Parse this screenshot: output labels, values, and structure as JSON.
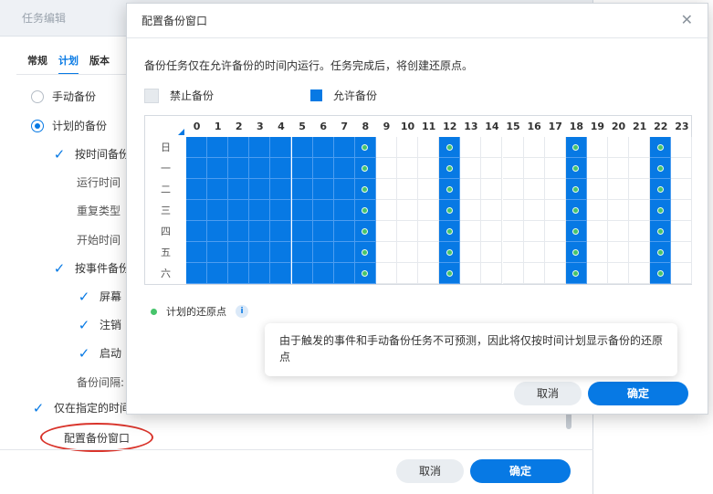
{
  "background_dialog": {
    "title": "任务编辑",
    "tabs": [
      {
        "label": "常规",
        "active": false
      },
      {
        "label": "计划",
        "active": true
      },
      {
        "label": "版本",
        "active": false
      }
    ],
    "options": {
      "manual_backup": "手动备份",
      "scheduled_backup": "计划的备份",
      "time_based_backup": "按时间备份",
      "run_time": "运行时间",
      "repeat_type": "重复类型",
      "start_time": "开始时间",
      "event_based_backup": "按事件备份",
      "event_screen": "屏幕",
      "event_logout": "注销",
      "event_startup": "启动",
      "backup_interval": "备份间隔:",
      "only_in_window": "仅在指定的时间"
    },
    "configure_link": "配置备份窗口",
    "cancel_label": "取消",
    "ok_label": "确定"
  },
  "dialog": {
    "title": "配置备份窗口",
    "close_icon": "close-icon",
    "description": "备份任务仅在允许备份的时间内运行。任务完成后，将创建还原点。",
    "legend": {
      "forbid": "禁止备份",
      "allow": "允许备份"
    },
    "restore_point_label": "计划的还原点",
    "info_icon_glyph": "i",
    "tooltip": "由于触发的事件和手动备份任务不可预测，因此将仅按时间计划显示备份的还原点",
    "cancel_label": "取消",
    "ok_label": "确定"
  },
  "schedule": {
    "hours": [
      "0",
      "1",
      "2",
      "3",
      "4",
      "5",
      "6",
      "7",
      "8",
      "9",
      "10",
      "11",
      "12",
      "13",
      "14",
      "15",
      "16",
      "17",
      "18",
      "19",
      "20",
      "21",
      "22",
      "23"
    ],
    "days": [
      "日",
      "一",
      "二",
      "三",
      "四",
      "五",
      "六"
    ],
    "allowed_hours": [
      0,
      1,
      2,
      3,
      4,
      5,
      6,
      7,
      8,
      12,
      18,
      22
    ],
    "restore_point_hours": [
      8,
      12,
      18,
      22
    ]
  },
  "colors": {
    "accent": "#0779e4",
    "restore_dot": "#46c46b",
    "highlight_oval": "#d9342b"
  }
}
